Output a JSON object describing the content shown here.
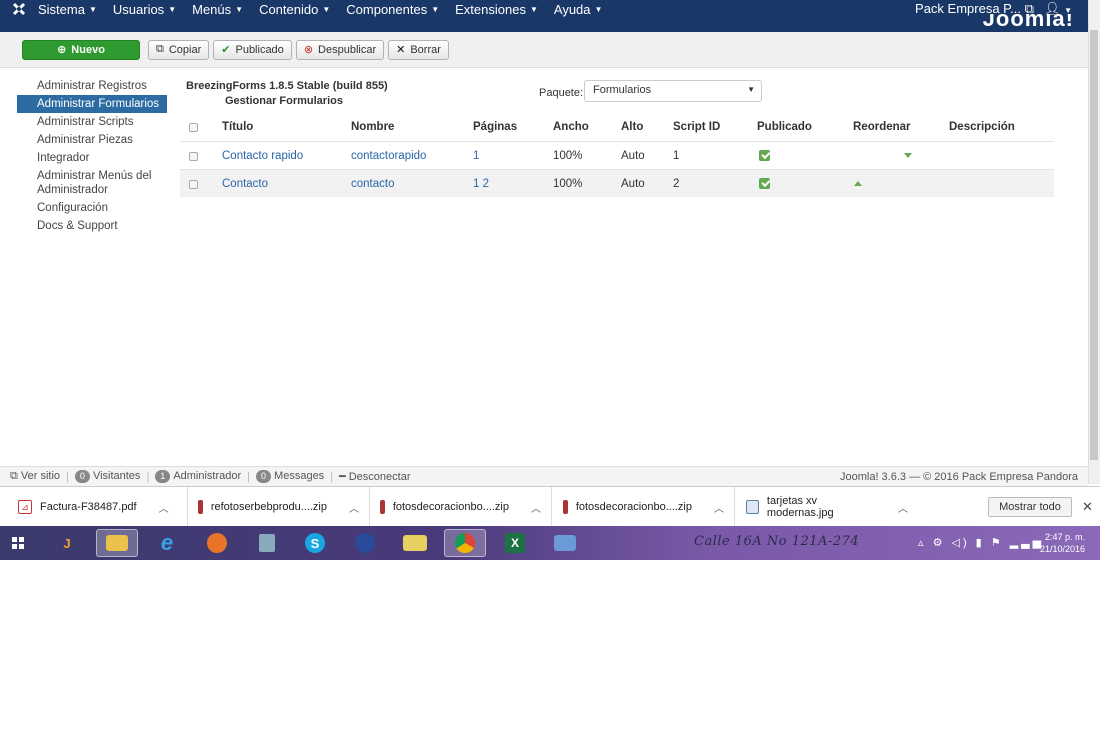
{
  "navbar": {
    "menus": [
      "Sistema",
      "Usuarios",
      "Menús",
      "Contenido",
      "Componentes",
      "Extensiones",
      "Ayuda"
    ],
    "site_name": "Pack Empresa P...",
    "brand": "Joomla!"
  },
  "toolbar": {
    "new_label": "Nuevo",
    "copy_label": "Copiar",
    "publish_label": "Publicado",
    "unpublish_label": "Despublicar",
    "delete_label": "Borrar"
  },
  "sidebar": {
    "items": [
      {
        "label": "Administrar Registros"
      },
      {
        "label": "Administrar Formularios"
      },
      {
        "label": "Administrar Scripts"
      },
      {
        "label": "Administrar Piezas"
      },
      {
        "label": "Integrador"
      },
      {
        "label": "Administrar Menús del Administrador"
      },
      {
        "label": "Configuración"
      },
      {
        "label": "Docs & Support"
      }
    ]
  },
  "main": {
    "title": "BreezingForms 1.8.5 Stable (build 855)",
    "subtitle": "Gestionar Formularios",
    "package_label": "Paquete:",
    "package_value": "Formularios",
    "columns": {
      "title": "Título",
      "name": "Nombre",
      "pages": "Páginas",
      "width": "Ancho",
      "height": "Alto",
      "script_id": "Script ID",
      "published": "Publicado",
      "reorder": "Reordenar",
      "description": "Descripción"
    },
    "rows": [
      {
        "title": "Contacto rapido",
        "name": "contactorapido",
        "pages": "1",
        "width": "100%",
        "height": "Auto",
        "script_id": "1"
      },
      {
        "title": "Contacto",
        "name": "contacto",
        "pages": "1 2",
        "width": "100%",
        "height": "Auto",
        "script_id": "2"
      }
    ]
  },
  "statusbar": {
    "view_site": "Ver sitio",
    "visitors_count": "0",
    "visitors_label": "Visitantes",
    "admin_count": "1",
    "admin_label": "Administrador",
    "messages_count": "0",
    "messages_label": "Messages",
    "logout_label": "Desconectar",
    "footer": "Joomla! 3.6.3 — © 2016 Pack Empresa Pandora"
  },
  "downloads": {
    "items": [
      {
        "name": "Factura-F38487.pdf"
      },
      {
        "name": "refotoserbebprodu....zip"
      },
      {
        "name": "fotosdecoracionbo....zip"
      },
      {
        "name": "fotosdecoracionbo....zip"
      },
      {
        "name": "tarjetas xv modernas.jpg"
      }
    ],
    "show_all": "Mostrar todo"
  },
  "taskbar": {
    "address_text": "Calle 16A No 121A-274",
    "time": "2:47 p. m.",
    "date": "21/10/2016"
  }
}
